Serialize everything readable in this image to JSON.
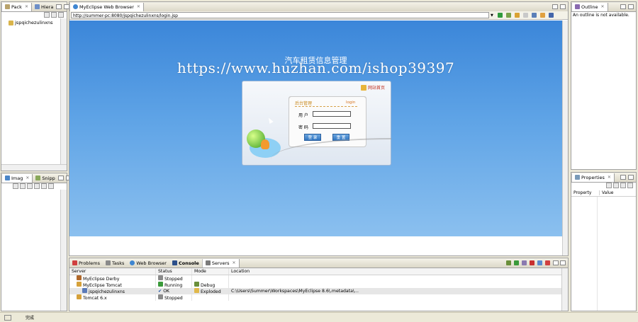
{
  "left_top": {
    "tab_pack": "Pack",
    "tab_hiera": "Hiera",
    "project": "jspqichezulinxns"
  },
  "left_bottom": {
    "tab_imag": "Imag",
    "tab_snipp": "Snipp"
  },
  "browser": {
    "tab": "MyEclipse Web Browser",
    "url": "http://summer-pc:8080/jspqichezulinxns/login.jsp",
    "site_title": "汽车租赁信息管理",
    "home_link": "网站首页",
    "panel_title": "后台管理",
    "panel_login": "login",
    "user_label": "用 户",
    "pass_label": "密 码",
    "btn_login": "登 录",
    "btn_reset": "重 置",
    "watermark": "https://www.huzhan.com/ishop39397"
  },
  "outline": {
    "tab": "Outline",
    "message": "An outline is not available."
  },
  "properties": {
    "tab": "Properties",
    "col_property": "Property",
    "col_value": "Value"
  },
  "bottom": {
    "tabs": [
      "Problems",
      "Tasks",
      "Web Browser",
      "Console",
      "Servers"
    ],
    "headers": [
      "Server",
      "Status",
      "Mode",
      "Location"
    ],
    "rows": [
      {
        "server": "MyEclipse Derby",
        "status": "Stopped",
        "mode": "",
        "location": ""
      },
      {
        "server": "MyEclipse Tomcat",
        "status": "Running",
        "mode": "Debug",
        "location": ""
      },
      {
        "server": "jspqichezulinxns",
        "status": "OK",
        "mode": "Exploded",
        "location": "C:\\Users\\Summer\\Workspaces\\MyEclipse 8.6\\.metadata\\..."
      },
      {
        "server": "Tomcat  6.x",
        "status": "Stopped",
        "mode": "",
        "location": ""
      }
    ]
  },
  "statusbar": {
    "text": "完成"
  },
  "colors": {
    "browser_bg": "#5b9de0",
    "accent": "#2f74c0"
  }
}
